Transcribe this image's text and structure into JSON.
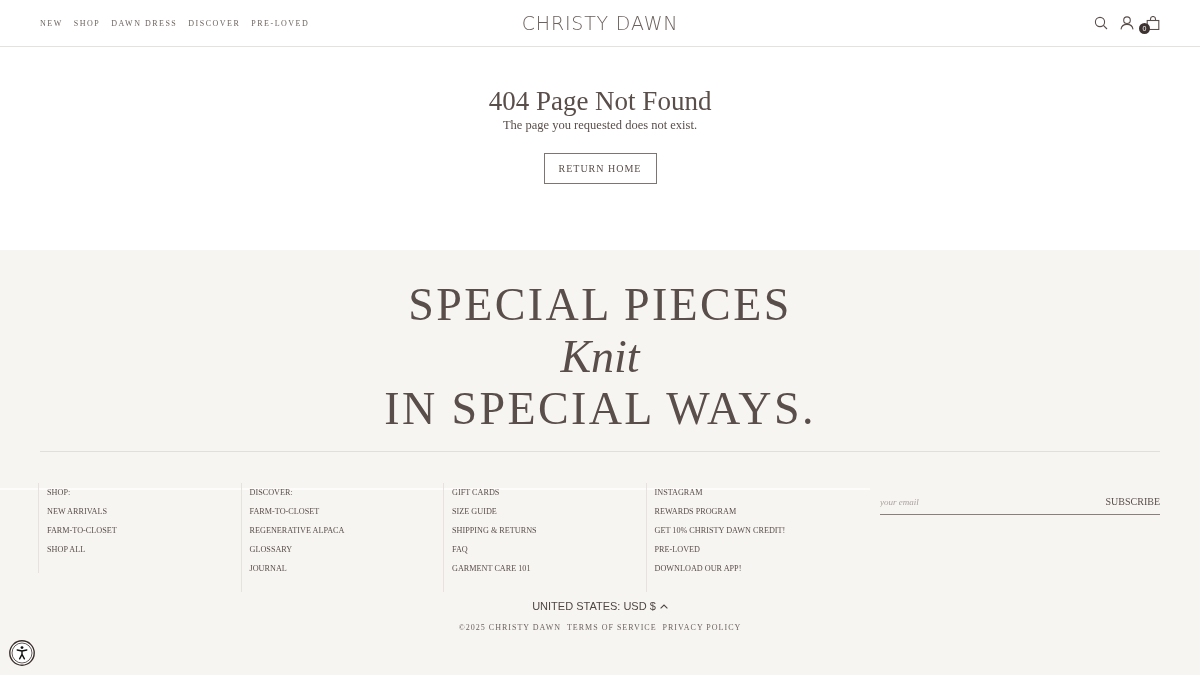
{
  "header": {
    "nav": [
      {
        "label": "NEW"
      },
      {
        "label": "SHOP"
      },
      {
        "label": "DAWN DRESS"
      },
      {
        "label": "DISCOVER"
      },
      {
        "label": "PRE-LOVED"
      }
    ],
    "logo": "CHRISTY DAWN",
    "cart_count": "0"
  },
  "not_found": {
    "title": "404 Page Not Found",
    "message": "The page you requested does not exist.",
    "button": "RETURN HOME"
  },
  "footer": {
    "headline": [
      {
        "text": "SPECIAL PIECES",
        "kind": "caps"
      },
      {
        "text": "Knit",
        "kind": "script"
      },
      {
        "text": "IN SPECIAL WAYS.",
        "kind": "caps"
      }
    ],
    "columns": [
      {
        "items": [
          "SHOP:",
          "NEW ARRIVALS",
          "FARM-TO-CLOSET",
          "SHOP ALL"
        ]
      },
      {
        "items": [
          "DISCOVER:",
          "FARM-TO-CLOSET",
          "REGENERATIVE ALPACA",
          "GLOSSARY",
          "JOURNAL"
        ]
      },
      {
        "items": [
          "GIFT CARDS",
          "SIZE GUIDE",
          "SHIPPING & RETURNS",
          "FAQ",
          "GARMENT CARE 101"
        ]
      },
      {
        "items": [
          "INSTAGRAM",
          "REWARDS PROGRAM",
          "GET 10% CHRISTY DAWN CREDIT!",
          "PRE-LOVED",
          "DOWNLOAD OUR APP!"
        ]
      }
    ],
    "newsletter": {
      "placeholder": "your email",
      "button": "SUBSCRIBE"
    },
    "currency": "UNITED STATES: USD $",
    "legal": [
      "©2025 CHRISTY DAWN",
      "TERMS OF SERVICE",
      "PRIVACY POLICY"
    ]
  }
}
